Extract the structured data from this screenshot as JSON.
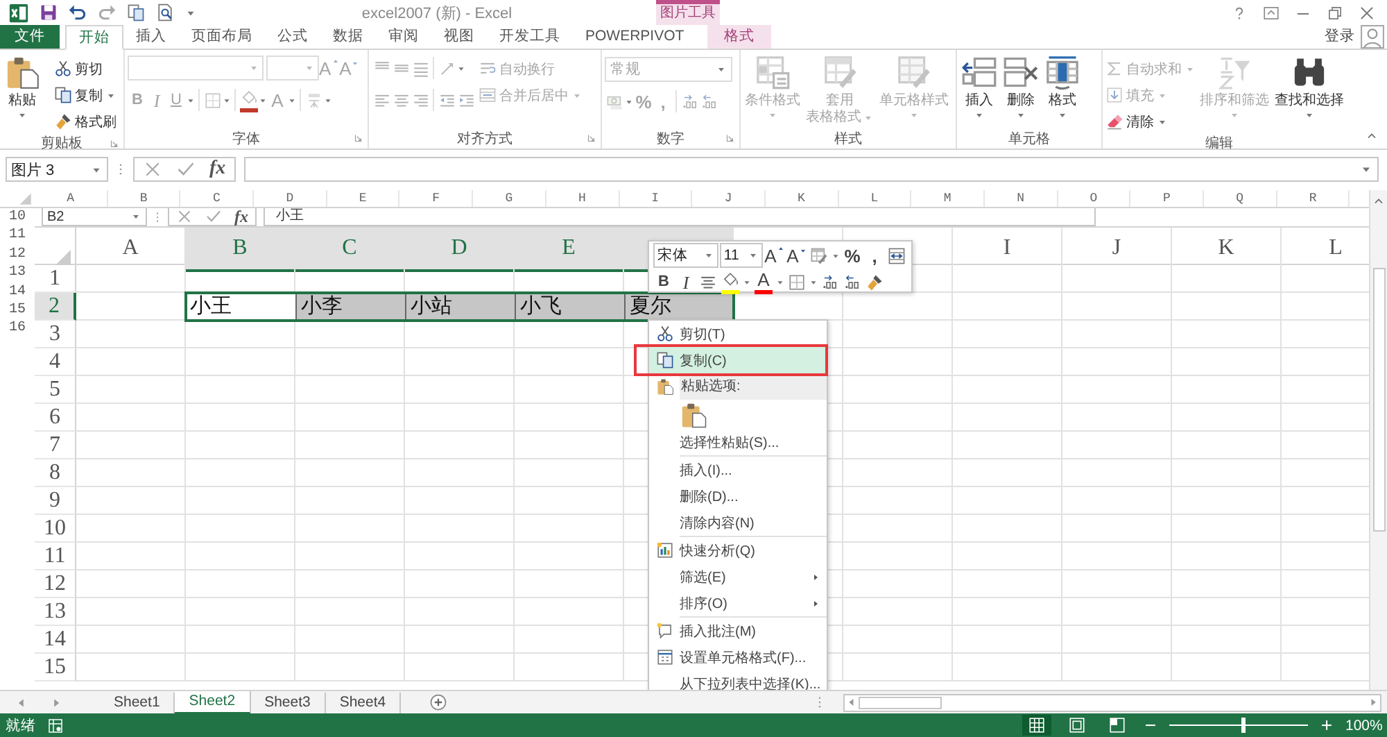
{
  "window": {
    "title": "excel2007 (新) - Excel",
    "contextual_group": "图片工具"
  },
  "tabs": [
    {
      "label": "文件",
      "kind": "file",
      "selected": false
    },
    {
      "label": "开始",
      "kind": "tab",
      "selected": true
    },
    {
      "label": "插入",
      "kind": "tab",
      "selected": false
    },
    {
      "label": "页面布局",
      "kind": "tab",
      "selected": false
    },
    {
      "label": "公式",
      "kind": "tab",
      "selected": false
    },
    {
      "label": "数据",
      "kind": "tab",
      "selected": false
    },
    {
      "label": "审阅",
      "kind": "tab",
      "selected": false
    },
    {
      "label": "视图",
      "kind": "tab",
      "selected": false
    },
    {
      "label": "开发工具",
      "kind": "tab",
      "selected": false
    },
    {
      "label": "POWERPIVOT",
      "kind": "tab",
      "selected": false
    },
    {
      "label": "格式",
      "kind": "contextual",
      "selected": false
    }
  ],
  "account": {
    "label": "登录"
  },
  "ribbon": {
    "groups": [
      {
        "label": "剪贴板",
        "dialog_launcher": true,
        "items": [
          {
            "kind": "paste",
            "label": "粘贴",
            "dropdown": true,
            "disabled": false
          },
          {
            "kind": "stack",
            "items": [
              {
                "kind": "cut",
                "label": "剪切",
                "disabled": false
              },
              {
                "kind": "copy",
                "label": "复制",
                "dropdown": true,
                "disabled": false
              },
              {
                "kind": "format_painter",
                "label": "格式刷",
                "disabled": false
              }
            ]
          }
        ]
      },
      {
        "label": "字体",
        "dialog_launcher": true,
        "items": [
          {
            "kind": "toolrows",
            "disabled": true,
            "rows": [
              [
                {
                  "kind": "font_name",
                  "dropdown": true
                },
                {
                  "kind": "font_size",
                  "dropdown": true
                },
                {
                  "kind": "grow",
                  "glyph": "A"
                },
                {
                  "kind": "shrink",
                  "glyph": "A"
                }
              ],
              [
                {
                  "kind": "bold",
                  "glyph": "B"
                },
                {
                  "kind": "italic",
                  "glyph": "I"
                },
                {
                  "kind": "underline",
                  "glyph": "U",
                  "dropdown": true
                },
                {
                  "kind": "separator"
                },
                {
                  "kind": "borders",
                  "dropdown": true
                },
                {
                  "kind": "separator"
                },
                {
                  "kind": "fill",
                  "color": "#c0392b",
                  "dropdown": true
                },
                {
                  "kind": "font_color",
                  "glyph": "A",
                  "dropdown": true
                },
                {
                  "kind": "separator"
                },
                {
                  "kind": "phonetic",
                  "dropdown": true
                }
              ]
            ]
          }
        ]
      },
      {
        "label": "对齐方式",
        "dialog_launcher": true,
        "items": [
          {
            "kind": "toolrows",
            "disabled": true,
            "rows": [
              [
                {
                  "kind": "align_top"
                },
                {
                  "kind": "align_middle"
                },
                {
                  "kind": "align_bottom"
                },
                {
                  "kind": "separator"
                },
                {
                  "kind": "orientation",
                  "dropdown": true
                }
              ],
              [
                {
                  "kind": "align_left"
                },
                {
                  "kind": "align_center"
                },
                {
                  "kind": "align_right"
                },
                {
                  "kind": "separator"
                },
                {
                  "kind": "decrease_indent"
                },
                {
                  "kind": "increase_indent"
                }
              ]
            ]
          },
          {
            "kind": "stack",
            "items": [
              {
                "kind": "wrap_text",
                "label": "自动换行",
                "disabled": true
              },
              {
                "kind": "merge_center",
                "label": "合并后居中",
                "dropdown": true,
                "disabled": true
              }
            ]
          }
        ]
      },
      {
        "label": "数字",
        "dialog_launcher": true,
        "items": [
          {
            "kind": "number_format",
            "value": "常规",
            "disabled": true
          },
          {
            "kind": "toolrows",
            "disabled": true,
            "rows": [
              [
                {
                  "kind": "accounting",
                  "dropdown": true
                },
                {
                  "kind": "percent",
                  "glyph": "%"
                },
                {
                  "kind": "comma",
                  "glyph": ","
                },
                {
                  "kind": "separator"
                },
                {
                  "kind": "increase_decimal"
                },
                {
                  "kind": "decrease_decimal"
                }
              ]
            ]
          }
        ]
      },
      {
        "label": "样式",
        "dialog_launcher": false,
        "items": [
          {
            "kind": "conditional",
            "label": "条件格式",
            "dropdown": true,
            "disabled": true
          },
          {
            "kind": "table_style",
            "label": [
              "套用",
              "表格格式"
            ],
            "dropdown": true,
            "disabled": true
          },
          {
            "kind": "cell_style",
            "label": "单元格样式",
            "dropdown": true,
            "disabled": true
          }
        ]
      },
      {
        "label": "单元格",
        "dialog_launcher": false,
        "items": [
          {
            "kind": "insert",
            "label": "插入",
            "dropdown": true,
            "disabled": false
          },
          {
            "kind": "delete",
            "label": "删除",
            "dropdown": true,
            "disabled": false
          },
          {
            "kind": "format",
            "label": "格式",
            "dropdown": true,
            "disabled": false
          }
        ]
      },
      {
        "label": "编辑",
        "dialog_launcher": false,
        "items": [
          {
            "kind": "stack",
            "items": [
              {
                "kind": "autosum",
                "label": "自动求和",
                "dropdown": true,
                "disabled": true
              },
              {
                "kind": "fill_down",
                "label": "填充",
                "dropdown": true,
                "disabled": true
              },
              {
                "kind": "clear",
                "label": "清除",
                "dropdown": true,
                "disabled": false
              }
            ]
          },
          {
            "kind": "sort_filter",
            "label": "排序和筛选",
            "dropdown": true,
            "disabled": true
          },
          {
            "kind": "find_select",
            "label": "查找和选择",
            "dropdown": true,
            "disabled": false
          }
        ]
      }
    ]
  },
  "formula_bar": {
    "name_box": "图片 3",
    "function_label": "fx"
  },
  "outer_sheet": {
    "columns": [
      "A",
      "B",
      "C",
      "D",
      "E",
      "F",
      "G",
      "H",
      "I",
      "J",
      "K",
      "L",
      "M",
      "N",
      "O",
      "P",
      "Q",
      "R"
    ],
    "rows": [
      "10",
      "11",
      "12",
      "13",
      "14",
      "15",
      "16"
    ]
  },
  "inner_sheet": {
    "name_box": "B2",
    "function_label": "fx",
    "formula": "小王",
    "columns": [
      {
        "label": "A",
        "selected": false
      },
      {
        "label": "B",
        "selected": true
      },
      {
        "label": "C",
        "selected": true
      },
      {
        "label": "D",
        "selected": true
      },
      {
        "label": "E",
        "selected": true
      },
      {
        "selected": true
      },
      {
        "selected": false
      },
      {
        "selected": false
      },
      {
        "label": "I",
        "selected": false
      },
      {
        "label": "J",
        "selected": false
      },
      {
        "label": "K",
        "selected": false
      },
      {
        "label": "L",
        "selected": false
      }
    ],
    "rows": [
      {
        "label": "1",
        "selected": false
      },
      {
        "label": "2",
        "selected": true,
        "cells": [
          null,
          {
            "value": "小王",
            "selected": true,
            "active": true
          },
          {
            "value": "小李",
            "selected": true,
            "active": false
          },
          {
            "value": "小站",
            "selected": true,
            "active": false
          },
          {
            "value": "小飞",
            "selected": true,
            "active": false
          },
          {
            "value": "夏尔",
            "selected": true,
            "active": false
          }
        ]
      },
      {
        "label": "3",
        "selected": false
      },
      {
        "label": "4",
        "selected": false
      },
      {
        "label": "5",
        "selected": false
      },
      {
        "label": "6",
        "selected": false
      },
      {
        "label": "7",
        "selected": false
      },
      {
        "label": "8",
        "selected": false
      },
      {
        "label": "9",
        "selected": false
      },
      {
        "label": "10",
        "selected": false
      },
      {
        "label": "11",
        "selected": false
      },
      {
        "label": "12",
        "selected": false
      },
      {
        "label": "13",
        "selected": false
      },
      {
        "label": "14",
        "selected": false
      },
      {
        "label": "15",
        "selected": false
      }
    ],
    "mini_toolbar": {
      "rows": [
        [
          {
            "kind": "font_name",
            "value": "宋体",
            "dropdown": true
          },
          {
            "kind": "font_size",
            "value": "11",
            "dropdown": true
          },
          {
            "kind": "grow",
            "glyph": "A"
          },
          {
            "kind": "shrink",
            "glyph": "A"
          },
          {
            "kind": "table_style",
            "dropdown": true
          },
          {
            "kind": "percent",
            "glyph": "%"
          },
          {
            "kind": "comma",
            "glyph": ","
          },
          {
            "kind": "column_width"
          }
        ],
        [
          {
            "kind": "bold",
            "glyph": "B"
          },
          {
            "kind": "italic",
            "glyph": "I"
          },
          {
            "kind": "align_center"
          },
          {
            "kind": "fill",
            "color": "#ffff00",
            "dropdown": true
          },
          {
            "kind": "font_color",
            "glyph": "A",
            "color": "#ff0000",
            "dropdown": true
          },
          {
            "kind": "borders",
            "dropdown": true
          },
          {
            "kind": "increase_decimal"
          },
          {
            "kind": "decrease_decimal"
          },
          {
            "kind": "format_painter"
          }
        ]
      ]
    },
    "context_menu": {
      "items": [
        {
          "kind": "cut",
          "label": "剪切(T)",
          "selected": false
        },
        {
          "kind": "copy",
          "label": "复制(C)",
          "selected": true
        },
        {
          "kind": "paste_header",
          "label": "粘贴选项:"
        },
        {
          "kind": "paste_buttons"
        },
        {
          "kind": "plain",
          "label": "选择性粘贴(S)...",
          "selected": false
        },
        {
          "kind": "separator"
        },
        {
          "kind": "plain",
          "label": "插入(I)...",
          "selected": false
        },
        {
          "kind": "plain",
          "label": "删除(D)...",
          "selected": false
        },
        {
          "kind": "plain",
          "label": "清除内容(N)",
          "selected": false
        },
        {
          "kind": "separator"
        },
        {
          "kind": "quick_analysis",
          "label": "快速分析(Q)",
          "selected": false
        },
        {
          "kind": "plain",
          "label": "筛选(E)",
          "submenu": true,
          "selected": false
        },
        {
          "kind": "plain",
          "label": "排序(O)",
          "submenu": true,
          "selected": false
        },
        {
          "kind": "separator"
        },
        {
          "kind": "comment",
          "label": "插入批注(M)",
          "selected": false
        },
        {
          "kind": "format_cells",
          "label": "设置单元格格式(F)...",
          "selected": false
        },
        {
          "kind": "plain",
          "label": "从下拉列表中选择(K)...",
          "selected": false
        }
      ]
    }
  },
  "sheet_tabs": [
    {
      "label": "Sheet1",
      "selected": false
    },
    {
      "label": "Sheet2",
      "selected": true
    },
    {
      "label": "Sheet3",
      "selected": false
    },
    {
      "label": "Sheet4",
      "selected": false
    }
  ],
  "status_bar": {
    "status": "就绪",
    "views": [
      {
        "kind": "normal",
        "selected": true
      },
      {
        "kind": "page_layout",
        "selected": false
      },
      {
        "kind": "page_break",
        "selected": false
      }
    ],
    "zoom": {
      "level": 0.53,
      "reading": "100%"
    }
  }
}
